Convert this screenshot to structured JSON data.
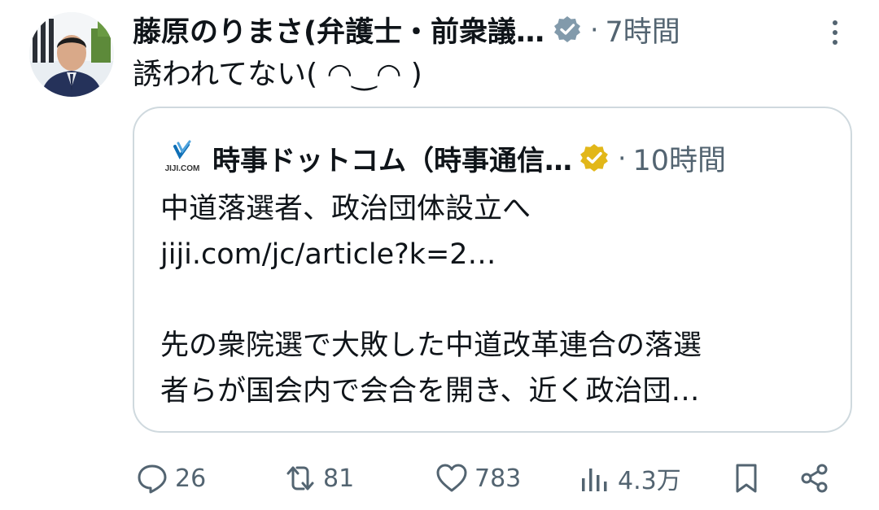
{
  "post": {
    "author": "藤原のりまさ(弁護士・前衆議…",
    "separator": "·",
    "time": "7時間",
    "text": "誘われてない( ◠‿◠ )"
  },
  "quote": {
    "account": "時事ドットコム（時事通信…",
    "separator": "·",
    "time": "10時間",
    "logo_text": "JIJI.COM",
    "lines": [
      "中道落選者、政治団体設立へ",
      "jiji.com/jc/article?k=2…",
      "",
      "先の衆院選で大敗した中道改革連合の落選",
      "者らが国会内で会合を開き、近く政治団…"
    ]
  },
  "actions": {
    "replies": "26",
    "reposts": "81",
    "likes": "783",
    "views": "4.3万"
  },
  "icons": {
    "verified_gray": "verified-badge-gray",
    "verified_gold": "verified-badge-gold",
    "more": "more-vertical-icon",
    "reply": "reply-icon",
    "repost": "repost-icon",
    "like": "heart-icon",
    "views": "views-icon",
    "bookmark": "bookmark-icon",
    "share": "share-icon"
  },
  "colors": {
    "text": "#0f1419",
    "secondary": "#536471",
    "border": "#cfd9de",
    "badge_gray": "#829aab",
    "badge_gold": "#e2b719",
    "jiji_blue": "#0f6fb6"
  }
}
